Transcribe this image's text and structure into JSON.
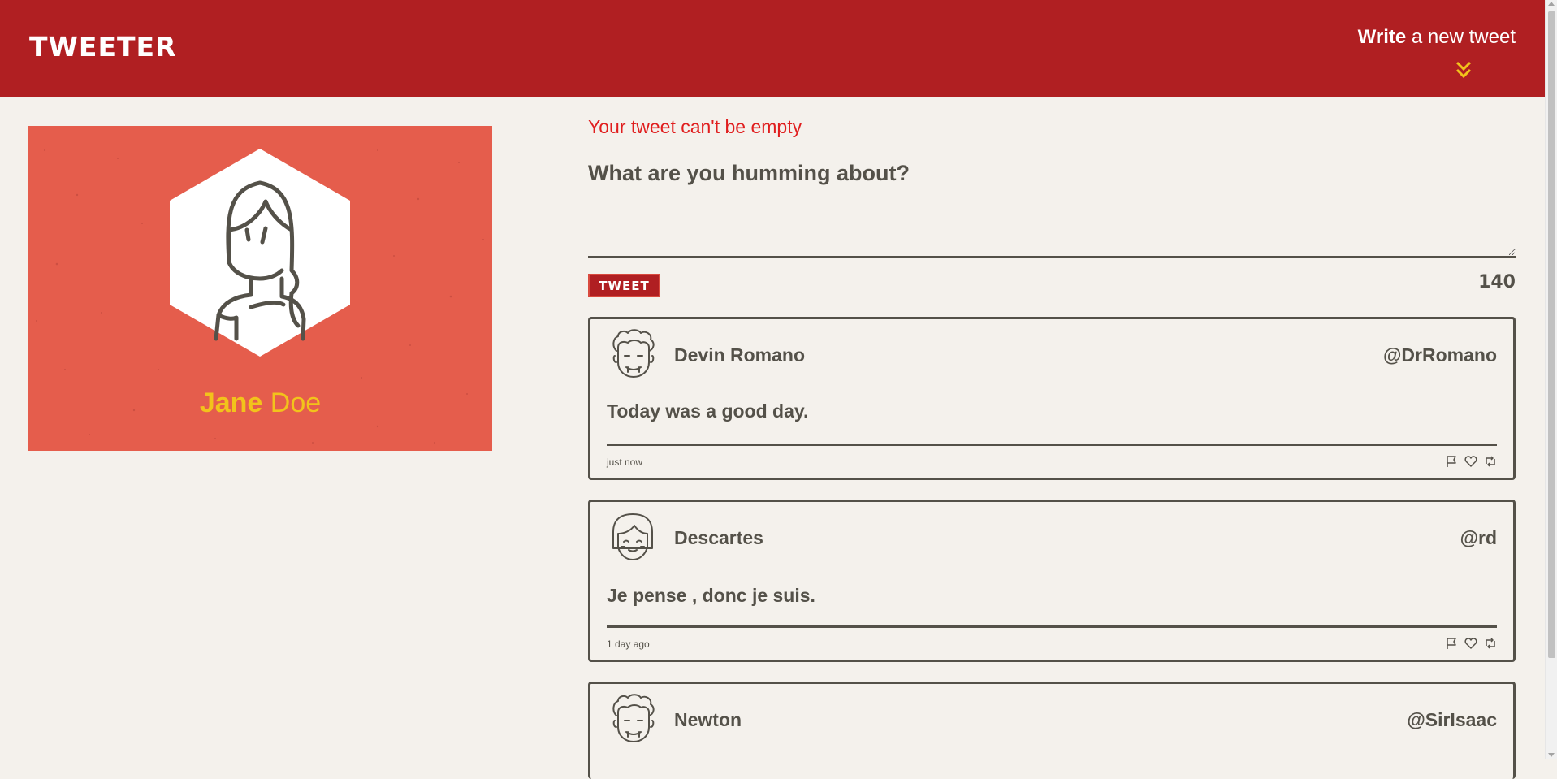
{
  "header": {
    "brand": "TWEETER",
    "compose_strong": "Write",
    "compose_rest": " a new tweet",
    "compose_icon": "double-chevron-down-icon",
    "accent_color": "#f2c31b",
    "bar_color": "#b01f22"
  },
  "profile": {
    "first_name": "Jane",
    "last_name": "Doe",
    "avatar_icon": "woman-avatar-icon",
    "bg_color": "#e55d4c"
  },
  "compose": {
    "error": "Your tweet can't be empty",
    "placeholder": "What are you humming about?",
    "value": "",
    "button_label": "TWEET",
    "counter": "140"
  },
  "tweets": [
    {
      "name": "Devin Romano",
      "handle": "@DrRomano",
      "content": "Today was a good day.",
      "time": "just now",
      "avatar_icon": "curly-hair-avatar-icon"
    },
    {
      "name": "Descartes",
      "handle": "@rd",
      "content": "Je pense , donc je suis.",
      "time": "1 day ago",
      "avatar_icon": "bob-hair-avatar-icon"
    },
    {
      "name": "Newton",
      "handle": "@SirIsaac",
      "content": "",
      "time": "",
      "avatar_icon": "curly-hair-avatar-icon"
    }
  ],
  "tweet_action_icons": [
    "flag-icon",
    "heart-icon",
    "retweet-icon"
  ]
}
